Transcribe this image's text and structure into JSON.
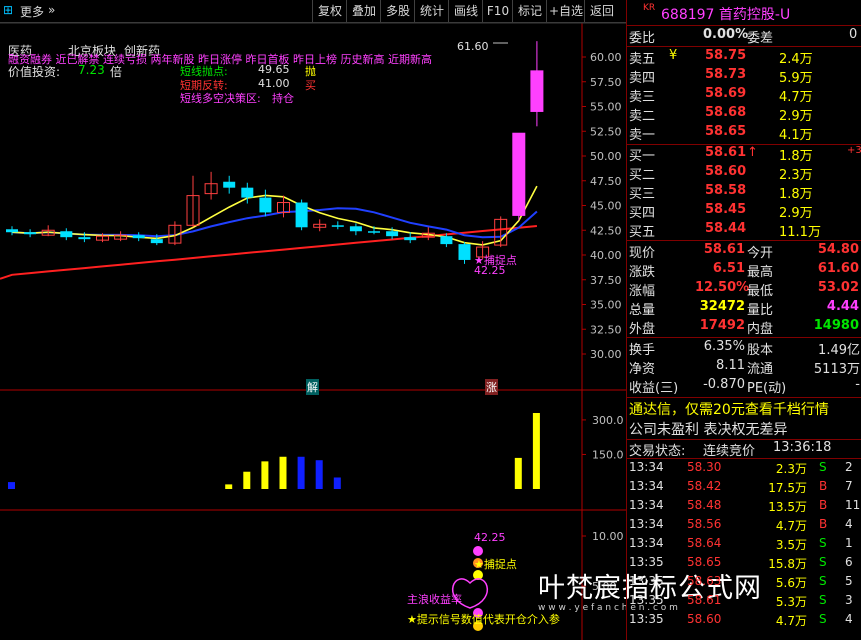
{
  "toolbar": {
    "left_icon": "⊞",
    "more": "更多",
    "more_arrow": "»",
    "buttons": [
      "复权",
      "叠加",
      "多股",
      "统计",
      "画线",
      "F10",
      "标记",
      "+自选",
      "返回"
    ]
  },
  "chart": {
    "sector_labels": [
      "医药",
      "北京板块",
      "创新药"
    ],
    "concept_line": "融资融券 近已解禁 连续亏损 两年新股 昨日涨停 昨日首板 昨日上榜 历史新高 近期新高",
    "value_invest_label": "价值投资:",
    "value_invest_value": "7.23",
    "value_invest_unit": "倍",
    "short_sell_label": "短线抛点:",
    "short_sell_value": "49.65",
    "short_sell_tag": "抛",
    "short_buy_label": "短期反转:",
    "short_buy_value": "41.00",
    "short_buy_tag": "买",
    "zone_label": "短线多空决策区:",
    "zone_value": "持仓",
    "high_marker": "61.60",
    "catch_label": "★捕捉点",
    "catch_value": "42.25",
    "jie_tag": "解",
    "zhang_tag": "涨",
    "price_axis": [
      "60.00",
      "57.50",
      "55.00",
      "52.50",
      "50.00",
      "47.50",
      "45.00",
      "42.50",
      "40.00",
      "37.50",
      "35.00",
      "32.50",
      "30.00"
    ],
    "volume_axis": [
      "300.0",
      "150.0"
    ],
    "indicator_axis": [
      "10.00",
      "5.00"
    ],
    "ind_catch_value": "42.25",
    "ind_catch_label": "★捕捉点",
    "main_profit_text": "主浪收益率",
    "hint_text": "★提示信号数值代表开仓介入参",
    "watermark": "叶梵宸指标公式网",
    "watermark_url": "w w w . y e f a n c h e n . c o m"
  },
  "candles": [
    {
      "o": 42.6,
      "c": 42.3,
      "h": 42.9,
      "l": 42.0,
      "up": false
    },
    {
      "o": 42.3,
      "c": 42.1,
      "h": 42.6,
      "l": 41.8,
      "up": false
    },
    {
      "o": 42.0,
      "c": 42.5,
      "h": 43.0,
      "l": 41.9,
      "up": true
    },
    {
      "o": 42.4,
      "c": 41.8,
      "h": 42.7,
      "l": 41.5,
      "up": false
    },
    {
      "o": 41.8,
      "c": 41.6,
      "h": 42.3,
      "l": 41.3,
      "up": false
    },
    {
      "o": 41.5,
      "c": 41.9,
      "h": 42.2,
      "l": 41.3,
      "up": true
    },
    {
      "o": 41.6,
      "c": 42.0,
      "h": 42.4,
      "l": 41.4,
      "up": true
    },
    {
      "o": 42.0,
      "c": 41.7,
      "h": 42.3,
      "l": 41.4,
      "up": false
    },
    {
      "o": 41.6,
      "c": 41.2,
      "h": 42.1,
      "l": 41.0,
      "up": false
    },
    {
      "o": 41.2,
      "c": 43.0,
      "h": 43.4,
      "l": 41.0,
      "up": true
    },
    {
      "o": 43.0,
      "c": 46.0,
      "h": 48.0,
      "l": 42.8,
      "up": true
    },
    {
      "o": 46.2,
      "c": 47.2,
      "h": 48.4,
      "l": 45.6,
      "up": true
    },
    {
      "o": 47.4,
      "c": 46.8,
      "h": 48.0,
      "l": 46.2,
      "up": false
    },
    {
      "o": 46.8,
      "c": 45.8,
      "h": 47.3,
      "l": 45.2,
      "up": false
    },
    {
      "o": 45.8,
      "c": 44.3,
      "h": 46.6,
      "l": 43.9,
      "up": false
    },
    {
      "o": 44.3,
      "c": 45.3,
      "h": 46.0,
      "l": 43.8,
      "up": true
    },
    {
      "o": 45.3,
      "c": 42.8,
      "h": 45.6,
      "l": 42.5,
      "up": false
    },
    {
      "o": 42.8,
      "c": 43.1,
      "h": 43.6,
      "l": 42.4,
      "up": true
    },
    {
      "o": 43.0,
      "c": 43.0,
      "h": 43.4,
      "l": 42.6,
      "up": false
    },
    {
      "o": 42.9,
      "c": 42.4,
      "h": 43.2,
      "l": 42.0,
      "up": false
    },
    {
      "o": 42.4,
      "c": 42.4,
      "h": 42.9,
      "l": 42.1,
      "up": false
    },
    {
      "o": 42.4,
      "c": 41.9,
      "h": 42.8,
      "l": 41.6,
      "up": false
    },
    {
      "o": 41.8,
      "c": 41.5,
      "h": 42.3,
      "l": 41.2,
      "up": false
    },
    {
      "o": 41.8,
      "c": 42.2,
      "h": 42.8,
      "l": 41.5,
      "up": true
    },
    {
      "o": 41.9,
      "c": 41.1,
      "h": 42.2,
      "l": 40.8,
      "up": false
    },
    {
      "o": 41.1,
      "c": 39.5,
      "h": 41.3,
      "l": 39.1,
      "up": false
    },
    {
      "o": 39.8,
      "c": 40.8,
      "h": 41.4,
      "l": 39.6,
      "up": true
    },
    {
      "o": 41.0,
      "c": 43.6,
      "h": 43.9,
      "l": 40.8,
      "up": true
    },
    {
      "o": 44.0,
      "c": 52.3,
      "h": 52.3,
      "l": 43.5,
      "up": true
    },
    {
      "o": 54.5,
      "c": 58.6,
      "h": 61.6,
      "l": 53.0,
      "up": true
    }
  ],
  "volumes": [
    {
      "v": 30,
      "up": false
    },
    {
      "v": 0,
      "up": false
    },
    {
      "v": 0,
      "up": false
    },
    {
      "v": 0,
      "up": false
    },
    {
      "v": 0,
      "up": false
    },
    {
      "v": 0,
      "up": false
    },
    {
      "v": 0,
      "up": false
    },
    {
      "v": 0,
      "up": false
    },
    {
      "v": 0,
      "up": false
    },
    {
      "v": 0,
      "up": false
    },
    {
      "v": 0,
      "up": false
    },
    {
      "v": 0,
      "up": false
    },
    {
      "v": 20,
      "up": true
    },
    {
      "v": 75,
      "up": true
    },
    {
      "v": 120,
      "up": true
    },
    {
      "v": 140,
      "up": true
    },
    {
      "v": 140,
      "up": false
    },
    {
      "v": 125,
      "up": false
    },
    {
      "v": 50,
      "up": false
    },
    {
      "v": 0,
      "up": false
    },
    {
      "v": 0,
      "up": false
    },
    {
      "v": 0,
      "up": false
    },
    {
      "v": 0,
      "up": false
    },
    {
      "v": 0,
      "up": false
    },
    {
      "v": 0,
      "up": false
    },
    {
      "v": 0,
      "up": false
    },
    {
      "v": 0,
      "up": false
    },
    {
      "v": 0,
      "up": false
    },
    {
      "v": 135,
      "up": true
    },
    {
      "v": 330,
      "up": true
    }
  ],
  "panel": {
    "market_tag": "KR",
    "title": "688197 首药控股-U",
    "weibi_label": "委比",
    "weibi_value": "0.00%",
    "weicha_label": "委差",
    "weicha_value": "0",
    "sells": [
      {
        "label": "卖五",
        "mark": "¥",
        "price": "58.75",
        "vol": "2.4万"
      },
      {
        "label": "卖四",
        "mark": "",
        "price": "58.73",
        "vol": "5.9万"
      },
      {
        "label": "卖三",
        "mark": "",
        "price": "58.69",
        "vol": "4.7万"
      },
      {
        "label": "卖二",
        "mark": "",
        "price": "58.68",
        "vol": "2.9万"
      },
      {
        "label": "卖一",
        "mark": "",
        "price": "58.65",
        "vol": "4.1万"
      }
    ],
    "buys": [
      {
        "label": "买一",
        "mark": "↑",
        "price": "58.61",
        "vol": "1.8万",
        "extra": "+3"
      },
      {
        "label": "买二",
        "mark": "",
        "price": "58.60",
        "vol": "2.3万",
        "extra": ""
      },
      {
        "label": "买三",
        "mark": "",
        "price": "58.58",
        "vol": "1.8万",
        "extra": ""
      },
      {
        "label": "买四",
        "mark": "",
        "price": "58.45",
        "vol": "2.9万",
        "extra": ""
      },
      {
        "label": "买五",
        "mark": "",
        "price": "58.44",
        "vol": "11.1万",
        "extra": ""
      }
    ],
    "stats": [
      {
        "l1": "现价",
        "v1": "58.61",
        "c1": "red",
        "l2": "今开",
        "v2": "54.80",
        "c2": "red"
      },
      {
        "l1": "涨跌",
        "v1": "6.51",
        "c1": "red",
        "l2": "最高",
        "v2": "61.60",
        "c2": "red"
      },
      {
        "l1": "涨幅",
        "v1": "12.50%",
        "c1": "red",
        "l2": "最低",
        "v2": "53.02",
        "c2": "red"
      },
      {
        "l1": "总量",
        "v1": "32472",
        "c1": "yellow",
        "l2": "量比",
        "v2": "4.44",
        "c2": "mag"
      },
      {
        "l1": "外盘",
        "v1": "17492",
        "c1": "red",
        "l2": "内盘",
        "v2": "14980",
        "c2": "green"
      }
    ],
    "fin": [
      {
        "l1": "换手",
        "v1": "6.35%",
        "l2": "股本",
        "v2": "1.49亿"
      },
      {
        "l1": "净资",
        "v1": "8.11",
        "l2": "流通",
        "v2": "5113万"
      },
      {
        "l1": "收益(三)",
        "v1": "-0.870",
        "l2": "PE(动)",
        "v2": "-"
      }
    ],
    "promo": "通达信，仅需20元查看千档行情",
    "notice": "公司未盈利 表决权无差异",
    "trade_status_label": "交易状态:",
    "trade_status_value": "连续竞价",
    "trade_time": "13:36:18",
    "ticks": [
      {
        "t": "13:34",
        "p": "58.30",
        "v": "2.3万",
        "s": "S",
        "n": "2"
      },
      {
        "t": "13:34",
        "p": "58.42",
        "v": "17.5万",
        "s": "B",
        "n": "7"
      },
      {
        "t": "13:34",
        "p": "58.48",
        "v": "13.5万",
        "s": "B",
        "n": "11"
      },
      {
        "t": "13:34",
        "p": "58.56",
        "v": "4.7万",
        "s": "B",
        "n": "4"
      },
      {
        "t": "13:34",
        "p": "58.64",
        "v": "3.5万",
        "s": "S",
        "n": "1"
      },
      {
        "t": "13:35",
        "p": "58.65",
        "v": "15.8万",
        "s": "S",
        "n": "6"
      },
      {
        "t": "13:35",
        "p": "58.63",
        "v": "5.6万",
        "s": "S",
        "n": "5"
      },
      {
        "t": "13:35",
        "p": "58.61",
        "v": "5.3万",
        "s": "S",
        "n": "3"
      },
      {
        "t": "13:35",
        "p": "58.60",
        "v": "4.7万",
        "s": "S",
        "n": "4"
      }
    ]
  }
}
